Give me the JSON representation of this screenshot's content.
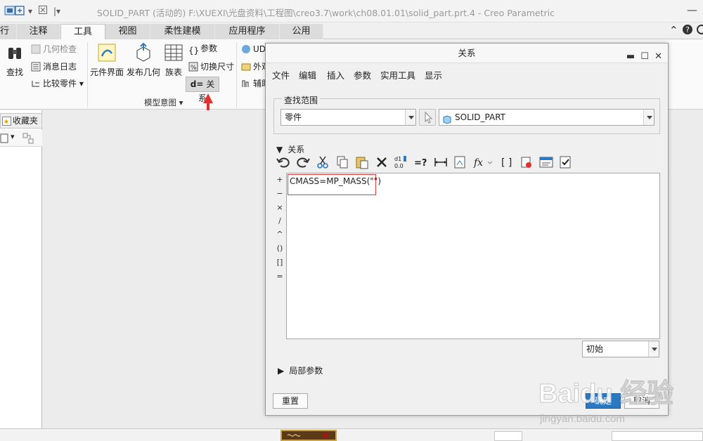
{
  "titlebar": {
    "title": "SOLID_PART (活动的) F:\\XUEXI\\光盘资料\\工程图\\creo3.7\\work\\ch08.01.01\\solid_part.prt.4 - Creo Parametric"
  },
  "ribbon": {
    "tabs": [
      {
        "label": "行"
      },
      {
        "label": "注释"
      },
      {
        "label": "工具"
      },
      {
        "label": "视图"
      },
      {
        "label": "柔性建模"
      },
      {
        "label": "应用程序"
      },
      {
        "label": "公用"
      }
    ],
    "active_tab": "工具",
    "find_label": "查找",
    "geometry_check": "几何检查",
    "message_log": "消息日志",
    "compare_part": "比较零件",
    "component_interface": "元件界面",
    "publish_geometry": "发布几何",
    "family_table": "族表",
    "parameters": "参数",
    "switch_dimensions": "切换尺寸",
    "relations": "关系",
    "relations_prefix": "d=",
    "model_intent_group": "模型意图",
    "udf_label": "UD",
    "external_label": "外观",
    "auxiliary_label": "辅助"
  },
  "left_panel": {
    "favorites_tab": "收藏夹"
  },
  "dialog": {
    "title": "关系",
    "menu": [
      "文件",
      "编辑",
      "插入",
      "参数",
      "实用工具",
      "显示"
    ],
    "lookup_scope_label": "查找范围",
    "scope_type": "零件",
    "scope_object": "SOLID_PART",
    "relations_section": "关系",
    "relation_text": "CMASS=MP_MASS(\"\")",
    "operators": [
      "+",
      "−",
      "×",
      "/",
      "^",
      "()",
      "[]",
      "="
    ],
    "units_select": "初始",
    "local_params_section": "局部参数",
    "reset_button": "重置",
    "ok_button": "确定",
    "cancel_button": "取消"
  },
  "watermark": {
    "brand": "Baidu 经验",
    "url": "jingyan.baidu.com"
  },
  "colors": {
    "highlight_box": "#e23b3b",
    "arrow": "#e53030",
    "accent_blue": "#2b78c4"
  }
}
